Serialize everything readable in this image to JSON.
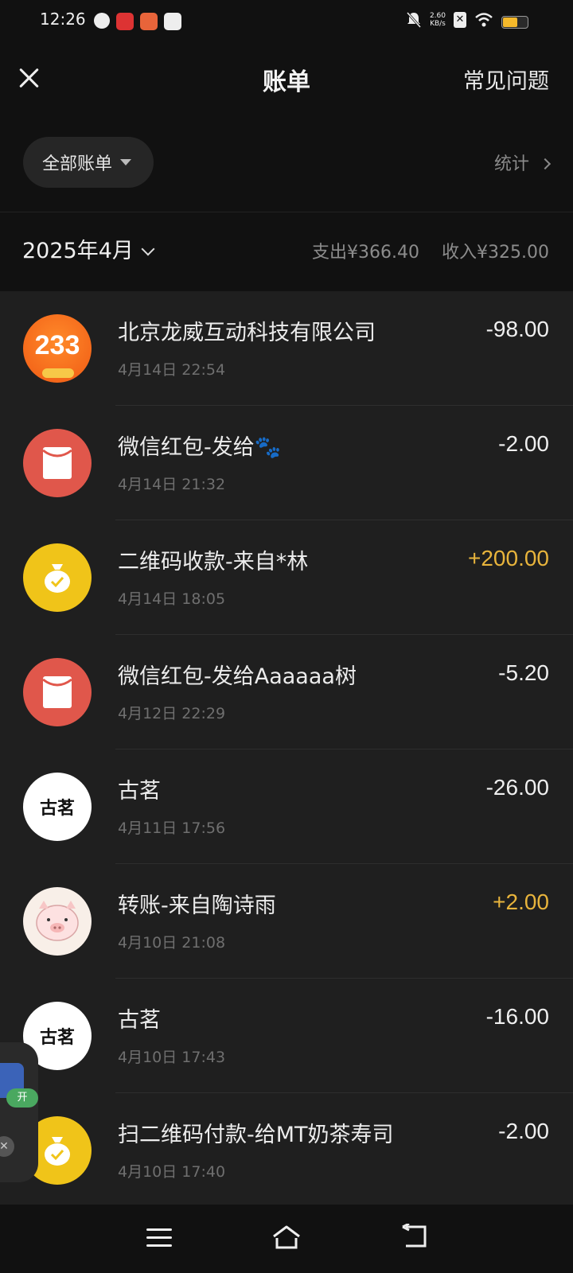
{
  "status_bar": {
    "time": "12:26",
    "net_speed_value": "2.60",
    "net_speed_unit": "KB/s"
  },
  "header": {
    "title": "账单",
    "faq": "常见问题"
  },
  "filter": {
    "label": "全部账单",
    "stats": "统计"
  },
  "month": {
    "label": "2025年4月",
    "expense": "支出¥366.40",
    "income": "收入¥325.00"
  },
  "transactions": [
    {
      "title": "北京龙威互动科技有限公司",
      "time": "4月14日 22:54",
      "amount": "-98.00",
      "icon": "app-233-icon",
      "avatar_text": "233"
    },
    {
      "title": "微信红包-发给🐾",
      "time": "4月14日 21:32",
      "amount": "-2.00",
      "icon": "red-packet-icon"
    },
    {
      "title": "二维码收款-来自*林",
      "time": "4月14日 18:05",
      "amount": "+200.00",
      "icon": "money-bag-icon"
    },
    {
      "title": "微信红包-发给Aaaaaa树",
      "time": "4月12日 22:29",
      "amount": "-5.20",
      "icon": "red-packet-icon"
    },
    {
      "title": "古茗",
      "time": "4月11日 17:56",
      "amount": "-26.00",
      "icon": "guming-logo-icon",
      "avatar_text": "古茗"
    },
    {
      "title": "转账-来自陶诗雨",
      "time": "4月10日 21:08",
      "amount": "+2.00",
      "icon": "pig-avatar-icon"
    },
    {
      "title": "古茗",
      "time": "4月10日 17:43",
      "amount": "-16.00",
      "icon": "guming-logo-icon",
      "avatar_text": "古茗"
    },
    {
      "title": "扫二维码付款-给MT奶茶寿司",
      "time": "4月10日 17:40",
      "amount": "-2.00",
      "icon": "money-bag-icon"
    }
  ],
  "floating_widget": {
    "badge": "开"
  },
  "colors": {
    "background": "#111111",
    "list_background": "#1f1f1f",
    "income": "#e8b43c",
    "red_packet": "#e0574b",
    "money_bag": "#f0c419",
    "app_233": "#f26a1b"
  }
}
